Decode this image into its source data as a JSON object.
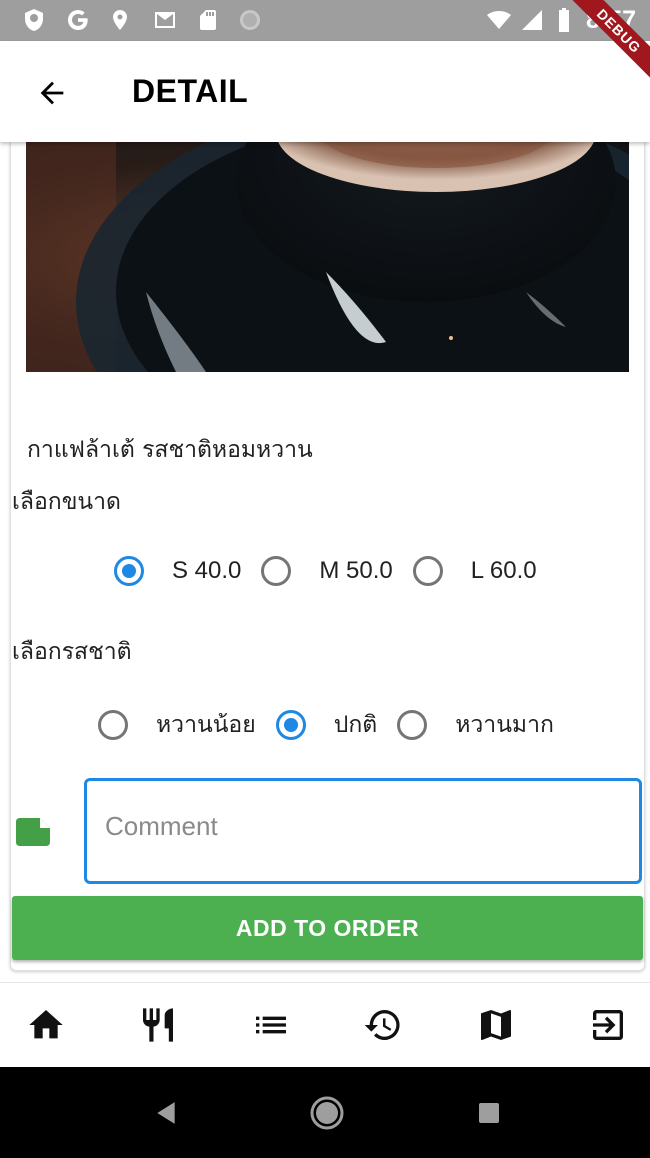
{
  "status_bar": {
    "time": "8:57",
    "debug_label": "DEBUG",
    "left_icons": [
      "shield-icon",
      "google-icon",
      "location-icon",
      "gmail-icon",
      "sd-card-icon",
      "sync-icon"
    ],
    "right_icons": [
      "wifi-icon",
      "signal-icon",
      "battery-icon"
    ]
  },
  "app_bar": {
    "title": "DETAIL",
    "back_icon": "arrow-back-icon"
  },
  "product": {
    "name": "กาแฟล้าเต้ รสชาติหอมหวาน",
    "image_description_icon": "coffee-photo"
  },
  "size_section": {
    "label": "เลือกขนาด",
    "options": [
      {
        "label": "S 40.0",
        "selected": true
      },
      {
        "label": "M 50.0",
        "selected": false
      },
      {
        "label": "L 60.0",
        "selected": false
      }
    ]
  },
  "taste_section": {
    "label": "เลือกรสชาติ",
    "options": [
      {
        "label": "หวานน้อย",
        "selected": false
      },
      {
        "label": "ปกติ",
        "selected": true
      },
      {
        "label": "หวานมาก",
        "selected": false
      }
    ]
  },
  "comment": {
    "placeholder": "Comment",
    "value": "",
    "icon": "note-icon"
  },
  "add_button": {
    "label": "ADD TO ORDER"
  },
  "bottom_nav": {
    "items": [
      "home-icon",
      "restaurant-icon",
      "list-icon",
      "history-icon",
      "map-icon",
      "exit-icon"
    ]
  },
  "system_nav": {
    "items": [
      "back-triangle-icon",
      "home-circle-icon",
      "recents-square-icon"
    ]
  },
  "colors": {
    "accent": "#1e88e5",
    "primary_button": "#4caf50",
    "status_bar": "#9e9e9e"
  }
}
